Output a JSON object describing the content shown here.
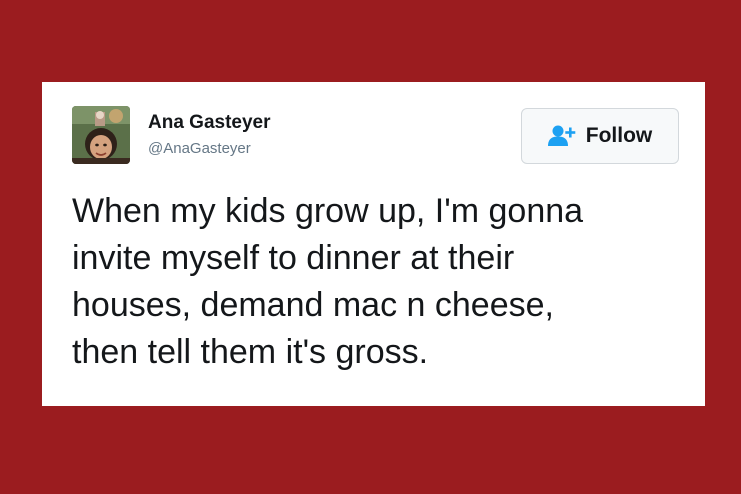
{
  "tweet": {
    "author": {
      "name": "Ana Gasteyer",
      "handle": "@AnaGasteyer",
      "avatar_icon": "profile-photo"
    },
    "follow_button": {
      "label": "Follow",
      "icon": "add-user-icon"
    },
    "text": "When my kids grow up, I'm gonna\ninvite myself to dinner at their\nhouses, demand mac n cheese,\nthen tell them it's gross."
  },
  "colors": {
    "background": "#9b1c1f",
    "card": "#ffffff",
    "accent": "#1da1f2",
    "text": "#14171a",
    "muted": "#657786"
  }
}
